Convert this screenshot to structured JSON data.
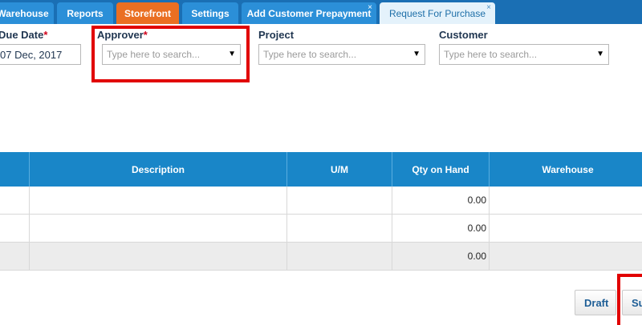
{
  "tabs": [
    {
      "label": "Warehouse"
    },
    {
      "label": "Reports"
    },
    {
      "label": "Storefront"
    },
    {
      "label": "Settings"
    },
    {
      "label": "Add Customer Prepayment",
      "close": "×"
    },
    {
      "label": "Request For Purchase",
      "close": "×"
    }
  ],
  "form": {
    "due_date": {
      "label": "Due Date",
      "required_mark": "*",
      "value": "07 Dec, 2017"
    },
    "approver": {
      "label": "Approver",
      "required_mark": "*",
      "placeholder": "Type here to search..."
    },
    "project": {
      "label": "Project",
      "placeholder": "Type here to search..."
    },
    "customer": {
      "label": "Customer",
      "placeholder": "Type here to search..."
    }
  },
  "table": {
    "columns": [
      "",
      "Description",
      "U/M",
      "Qty on Hand",
      "Warehouse"
    ],
    "rows": [
      {
        "qty_on_hand": "0.00"
      },
      {
        "qty_on_hand": "0.00"
      },
      {
        "qty_on_hand": "0.00"
      }
    ]
  },
  "buttons": {
    "draft": "Draft",
    "submit": "Su"
  },
  "colors": {
    "tabbar": "#1a6fb4",
    "tab": "#2b8fd8",
    "tab_orange": "#ea6f22",
    "tab_active": "#e4f2fb",
    "table_header": "#1986c8",
    "highlight": "#e10000"
  }
}
